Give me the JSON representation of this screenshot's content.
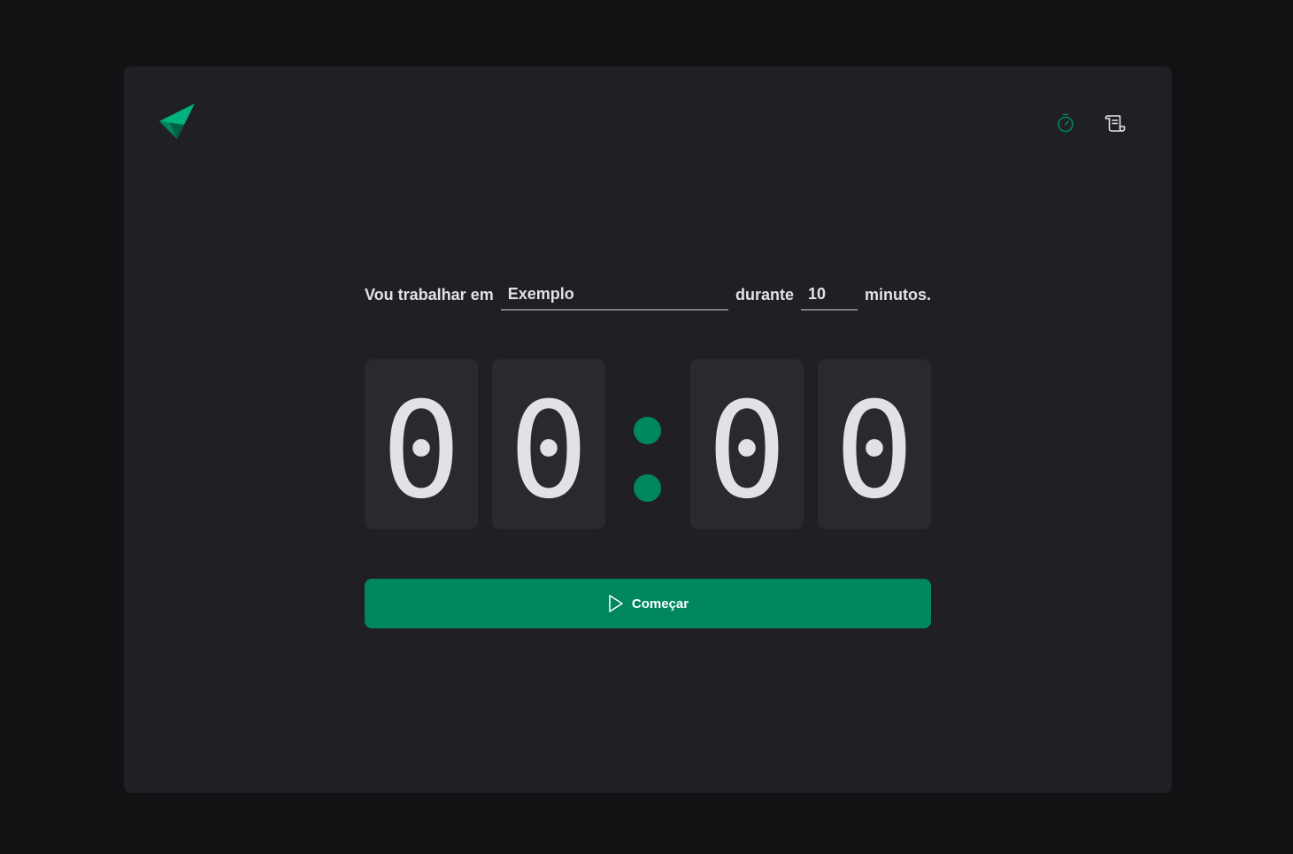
{
  "header": {
    "logo": "paper-plane-logo",
    "nav": [
      {
        "name": "timer-icon",
        "color": "#00875f",
        "active": true
      },
      {
        "name": "history-scroll-icon",
        "color": "#e1e1e6",
        "active": false
      }
    ]
  },
  "form": {
    "task_label": "Vou trabalhar em",
    "task_value": "Exemplo",
    "duration_label": "durante",
    "minutes_value": "10",
    "minutes_suffix": "minutos."
  },
  "countdown": {
    "minutes_tens": "0",
    "minutes_ones": "0",
    "seconds_tens": "0",
    "seconds_ones": "0"
  },
  "start_button": {
    "label": "Começar",
    "icon": "play-icon"
  },
  "colors": {
    "background": "#121214",
    "panel": "#202024",
    "digit_box": "#29292e",
    "accent": "#00875f",
    "text": "#e1e1e6",
    "input_border": "#7c7c8a"
  }
}
